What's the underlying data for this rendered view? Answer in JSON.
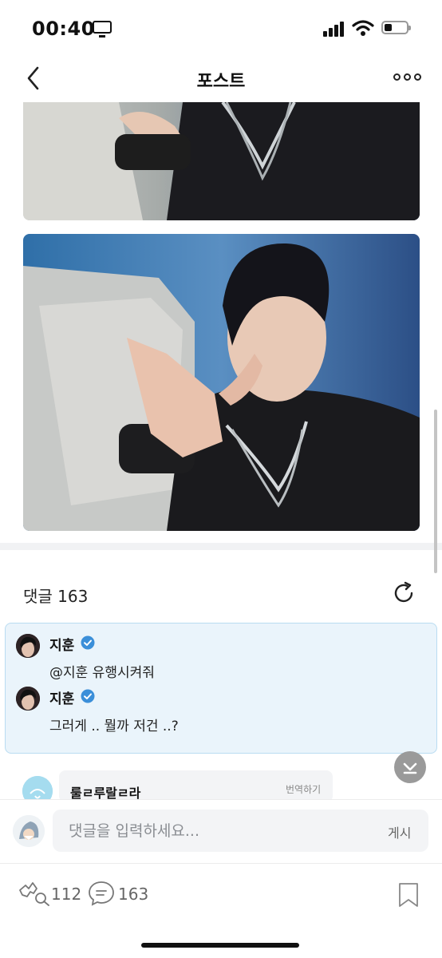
{
  "status_bar": {
    "time": "00:40"
  },
  "header": {
    "title": "포스트"
  },
  "comments": {
    "label": "댓글 163",
    "pinned": [
      {
        "author": "지훈",
        "text": "@지훈 유행시켜줘"
      },
      {
        "author": "지훈",
        "text": "그러게 .. 뭘까 저건 ..?"
      }
    ],
    "partial_comment": {
      "author": "룰ㄹ루랄ㄹ라",
      "translate_label": "번역하기"
    }
  },
  "input": {
    "placeholder": "댓글을 입력하세요...",
    "post_label": "게시"
  },
  "footer": {
    "likes": "112",
    "comments": "163"
  },
  "colors": {
    "accent": "#3b8fd9",
    "pinned_bg": "#eaf4fb"
  },
  "icons": [
    "back-chevron-icon",
    "more-icon",
    "refresh-icon",
    "verified-icon",
    "scroll-down-icon",
    "like-icon",
    "comment-icon",
    "bookmark-icon"
  ]
}
